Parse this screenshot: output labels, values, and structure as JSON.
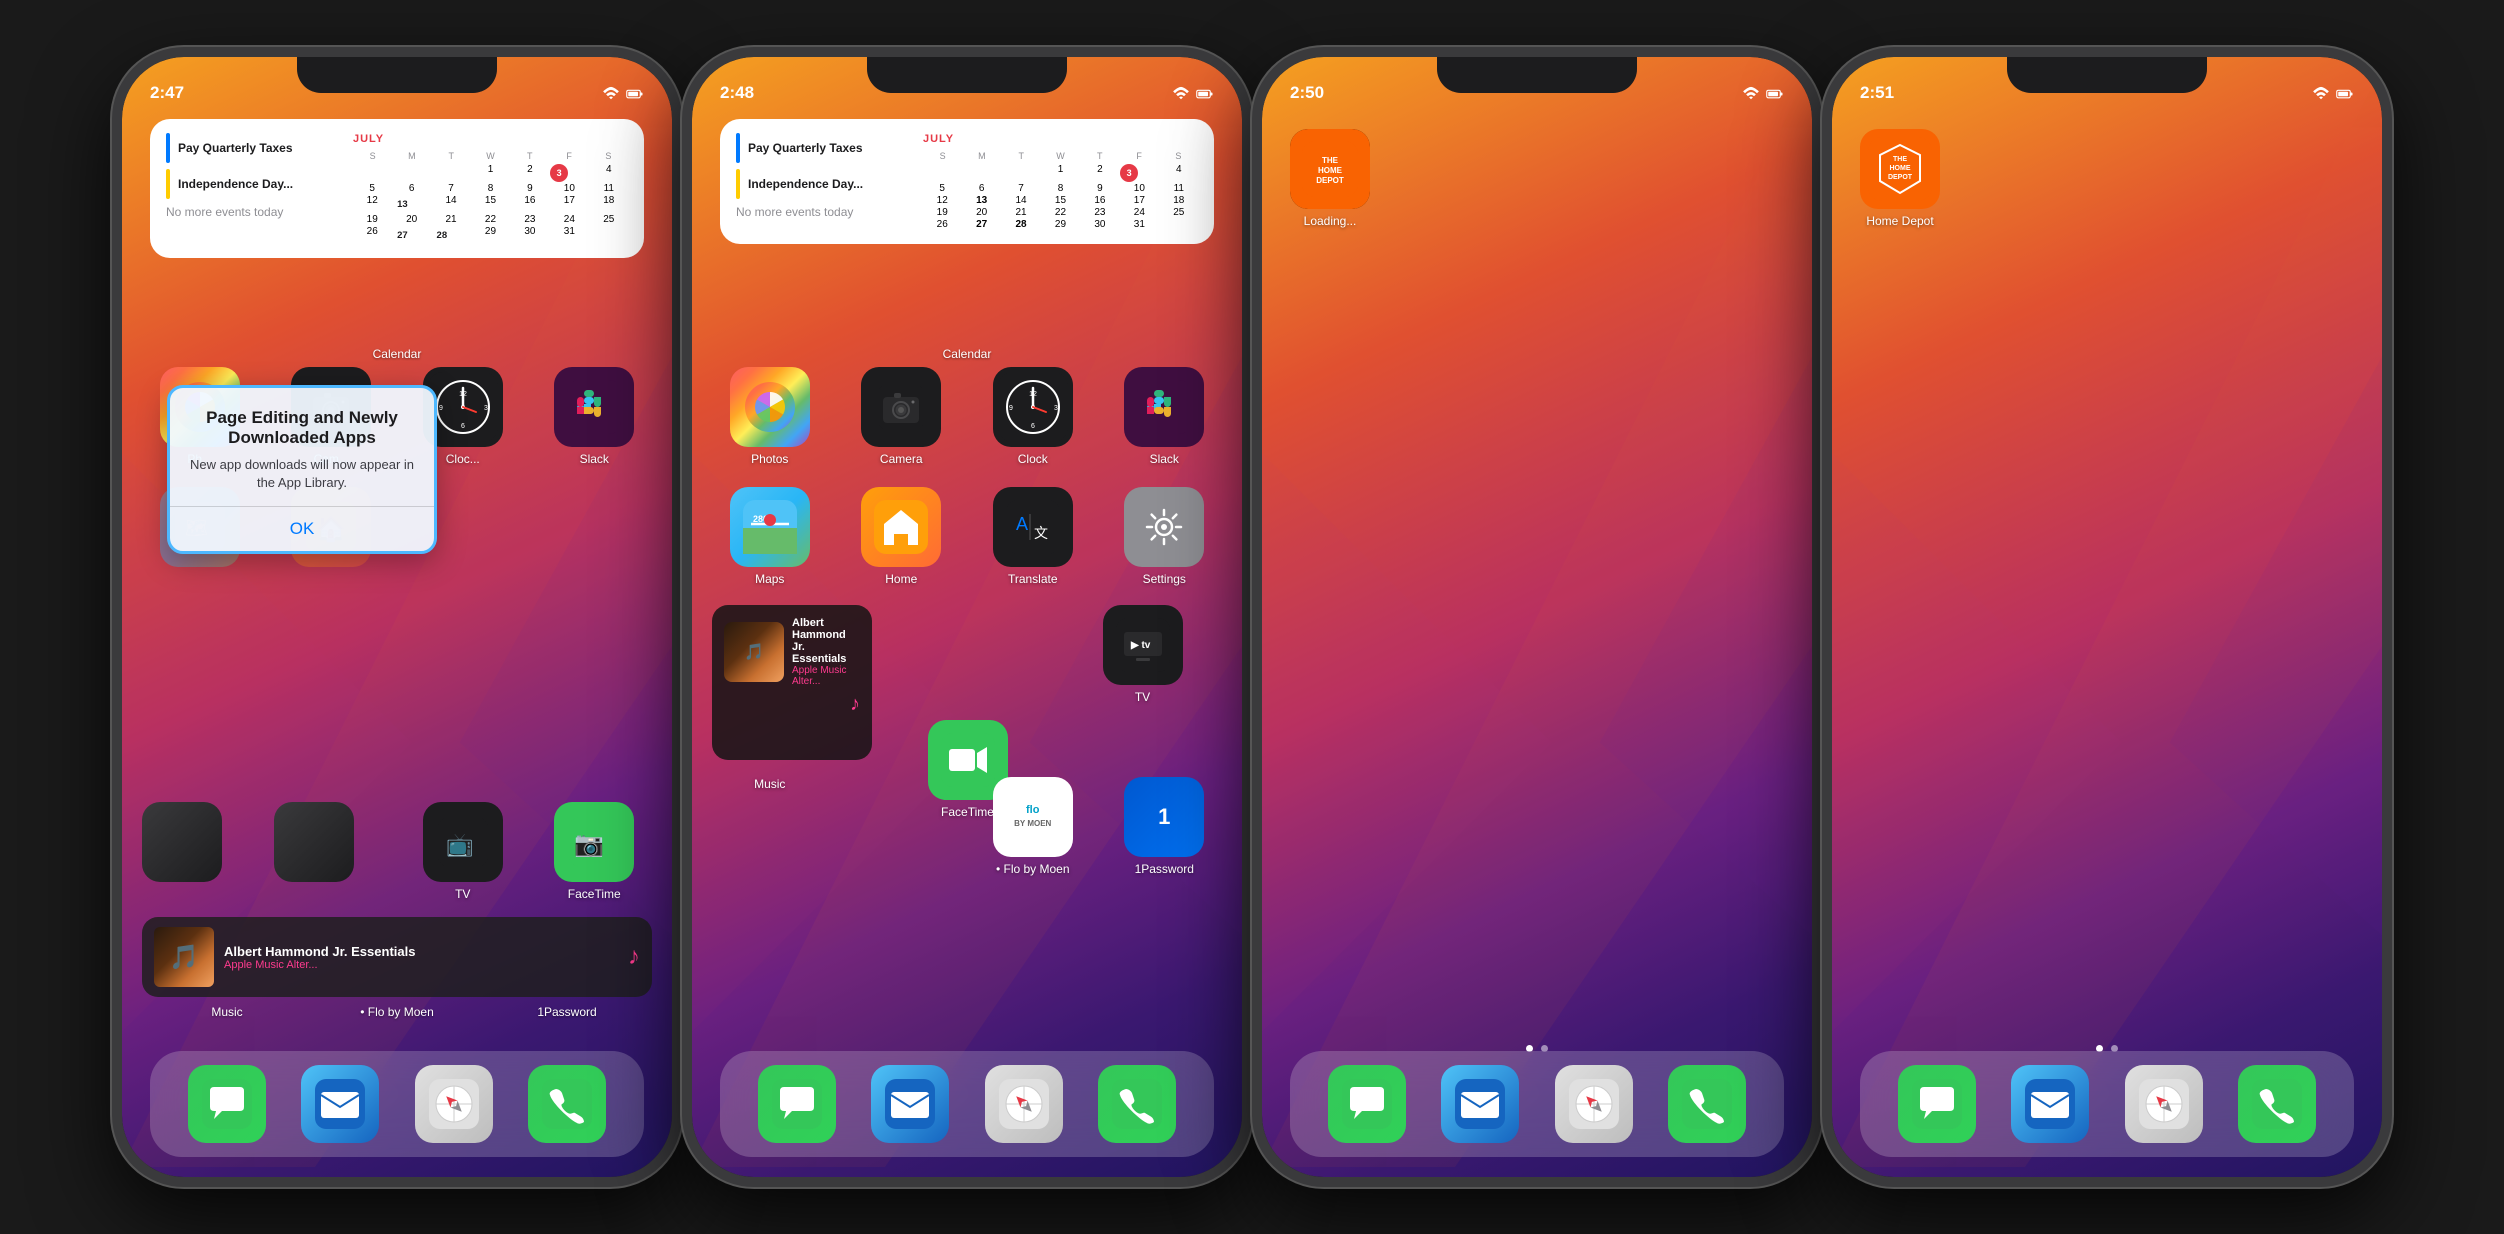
{
  "phones": [
    {
      "id": "phone1",
      "time": "2:47",
      "hasDialog": true,
      "dialog": {
        "title": "Page Editing and Newly Downloaded Apps",
        "body": "New app downloads will now appear in the App Library.",
        "button": "OK"
      }
    },
    {
      "id": "phone2",
      "time": "2:48",
      "hasDialog": false
    },
    {
      "id": "phone3",
      "time": "2:50",
      "hasDialog": false,
      "hasLoadingApp": true,
      "loadingApp": "Loading..."
    },
    {
      "id": "phone4",
      "time": "2:51",
      "hasDialog": false,
      "hasHomeDepot": true,
      "homeDepotLabel": "Home Depot"
    }
  ],
  "calendar": {
    "month": "JULY",
    "events": [
      {
        "color": "blue",
        "label": "Pay Quarterly Taxes"
      },
      {
        "color": "yellow",
        "label": "Independence Day..."
      }
    ],
    "noEvents": "No more events today",
    "dayHeaders": [
      "S",
      "M",
      "T",
      "W",
      "T",
      "F",
      "S"
    ],
    "days": [
      [
        "",
        "",
        "",
        "1",
        "2",
        "3",
        "4"
      ],
      [
        "5",
        "6",
        "7",
        "8",
        "9",
        "10",
        "11"
      ],
      [
        "12",
        "13",
        "14",
        "15",
        "16",
        "17",
        "18"
      ],
      [
        "19",
        "20",
        "21",
        "22",
        "23",
        "24",
        "25"
      ],
      [
        "26",
        "27",
        "28",
        "29",
        "30",
        "31",
        ""
      ]
    ],
    "today": "3"
  },
  "apps": {
    "row1": [
      "Photos",
      "Camera",
      "Clock",
      "Slack"
    ],
    "row2": [
      "Maps",
      "Home",
      "Translate",
      "Settings"
    ],
    "row3_p1": [
      "",
      "",
      "TV",
      "FaceTime"
    ],
    "music": {
      "title": "Albert Hammond Jr. Essentials",
      "subtitle": "Apple Music Alter..."
    }
  },
  "dock": {
    "apps": [
      "Messages",
      "Mail",
      "Safari",
      "Phone"
    ]
  },
  "labels": {
    "calendar": "Calendar",
    "photos": "Photos",
    "camera": "Camera",
    "clock": "Clock",
    "slack": "Slack",
    "maps": "Maps",
    "home": "Home",
    "translate": "Translate",
    "settings": "Settings",
    "tv": "TV",
    "facetime": "FaceTime",
    "music": "Music",
    "flo": "Flo by Moen",
    "onepassword": "1Password",
    "homedepot": "Home Depot",
    "loading": "Loading..."
  }
}
